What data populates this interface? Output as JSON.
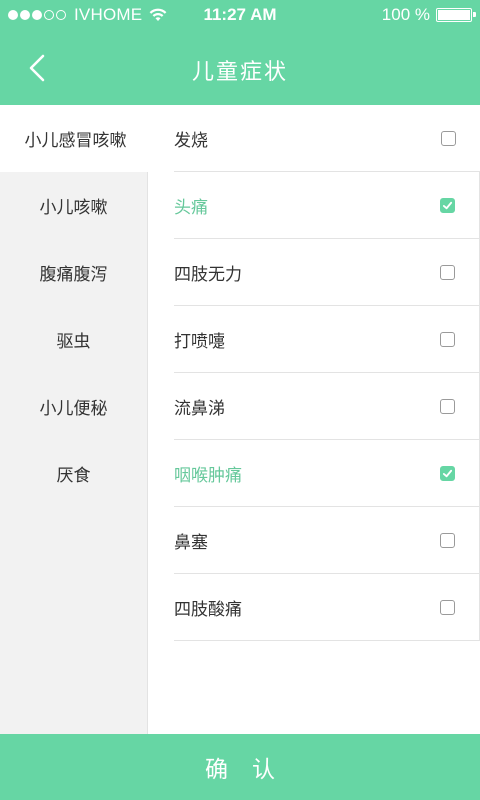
{
  "status_bar": {
    "carrier": "IVHOME",
    "time": "11:27 AM",
    "battery_text": "100 %",
    "battery_level": 1.0
  },
  "nav": {
    "title": "儿童症状",
    "back_icon": "chevron-left-icon"
  },
  "sidebar": {
    "active_index": 0,
    "items": [
      {
        "label": "小儿感冒咳嗽"
      },
      {
        "label": "小儿咳嗽"
      },
      {
        "label": "腹痛腹泻"
      },
      {
        "label": "驱虫"
      },
      {
        "label": "小儿便秘"
      },
      {
        "label": "厌食"
      }
    ]
  },
  "symptoms": [
    {
      "label": "发烧",
      "checked": false
    },
    {
      "label": "头痛",
      "checked": true
    },
    {
      "label": "四肢无力",
      "checked": false
    },
    {
      "label": "打喷嚏",
      "checked": false
    },
    {
      "label": "流鼻涕",
      "checked": false
    },
    {
      "label": "咽喉肿痛",
      "checked": true
    },
    {
      "label": "鼻塞",
      "checked": false
    },
    {
      "label": "四肢酸痛",
      "checked": false
    }
  ],
  "confirm": {
    "label": "确认"
  },
  "colors": {
    "accent": "#66d6a4",
    "checked_text": "#66c89b",
    "sidebar_bg": "#f2f2f2"
  }
}
